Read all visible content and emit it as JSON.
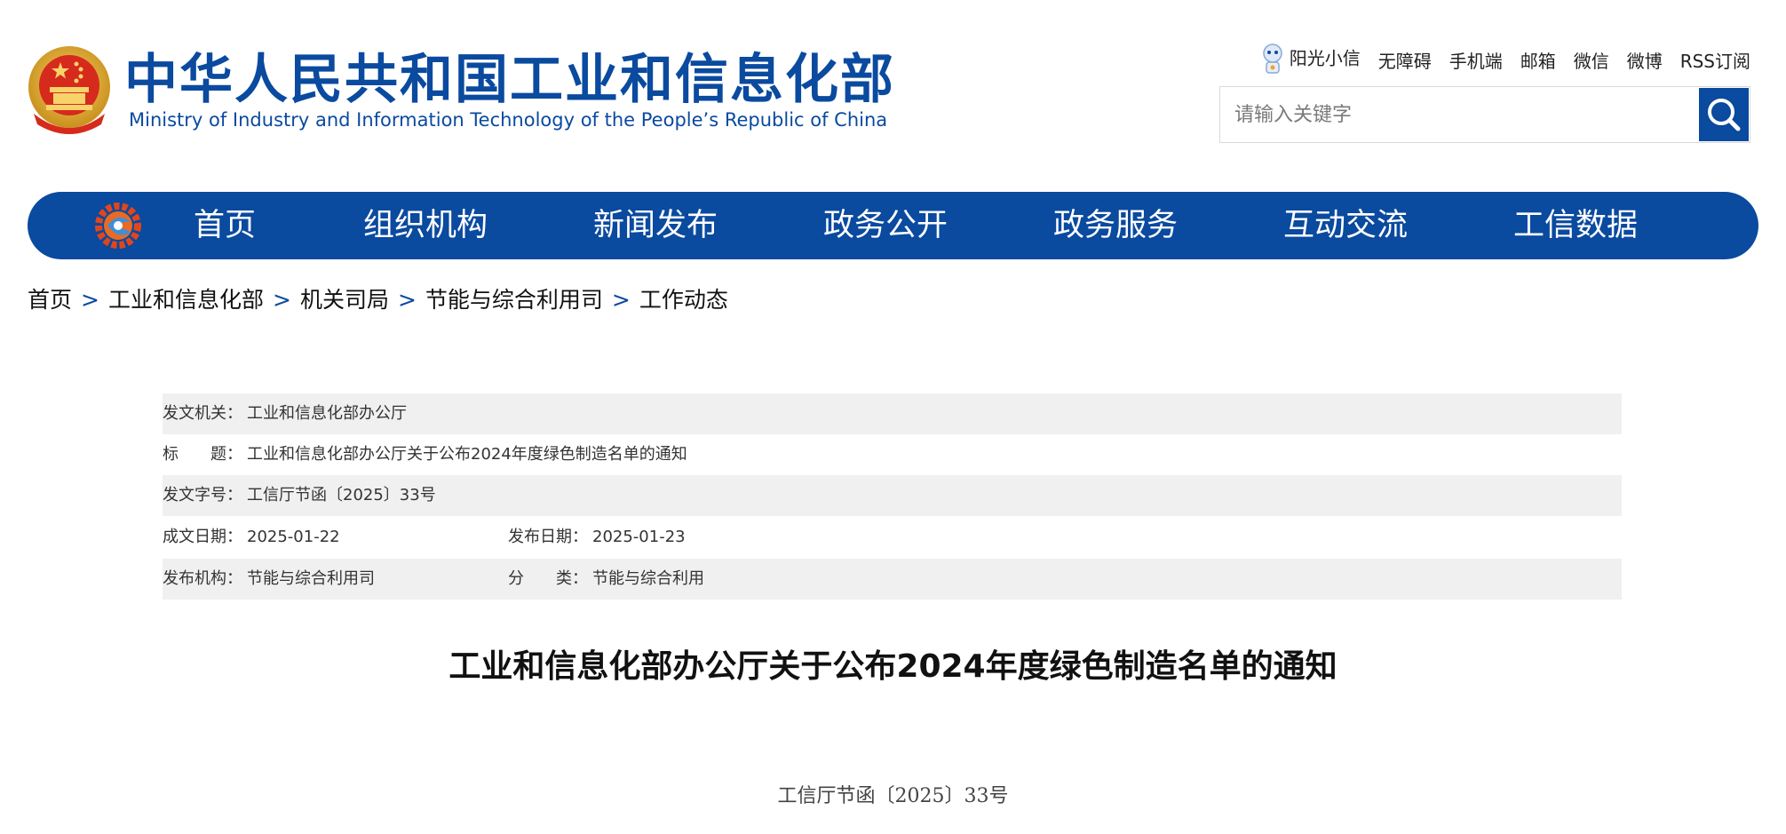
{
  "header": {
    "title_cn": "中华人民共和国工业和信息化部",
    "title_en": "Ministry of Industry and Information Technology of the People’s Republic of China",
    "toplinks": [
      "阳光小信",
      "无障碍",
      "手机端",
      "邮箱",
      "微信",
      "微博",
      "RSS订阅"
    ],
    "search": {
      "placeholder": "请输入关键字"
    }
  },
  "nav": {
    "items": [
      "首页",
      "组织机构",
      "新闻发布",
      "政务公开",
      "政务服务",
      "互动交流",
      "工信数据"
    ]
  },
  "breadcrumb": [
    "首页",
    "工业和信息化部",
    "机关司局",
    "节能与综合利用司",
    "工作动态"
  ],
  "meta": {
    "issuer_label": "发文机关：",
    "issuer": "工业和信息化部办公厅",
    "title_label": "标　　题：",
    "title": "工业和信息化部办公厅关于公布2024年度绿色制造名单的通知",
    "docno_label": "发文字号：",
    "docno": "工信厅节函〔2025〕33号",
    "written_label": "成文日期：",
    "written": "2025-01-22",
    "published_label": "发布日期：",
    "published": "2025-01-23",
    "org_label": "发布机构：",
    "org": "节能与综合利用司",
    "category_label": "分　　类：",
    "category": "节能与综合利用"
  },
  "article": {
    "title": "工业和信息化部办公厅关于公布2024年度绿色制造名单的通知",
    "number": "工信厅节函〔2025〕33号"
  },
  "colors": {
    "brand_blue": "#0a4a9f",
    "row_shade": "#f0f0f0"
  },
  "icons": [
    "national-emblem-icon",
    "robot-mascot-icon",
    "search-icon",
    "miit-gear-logo-icon"
  ]
}
